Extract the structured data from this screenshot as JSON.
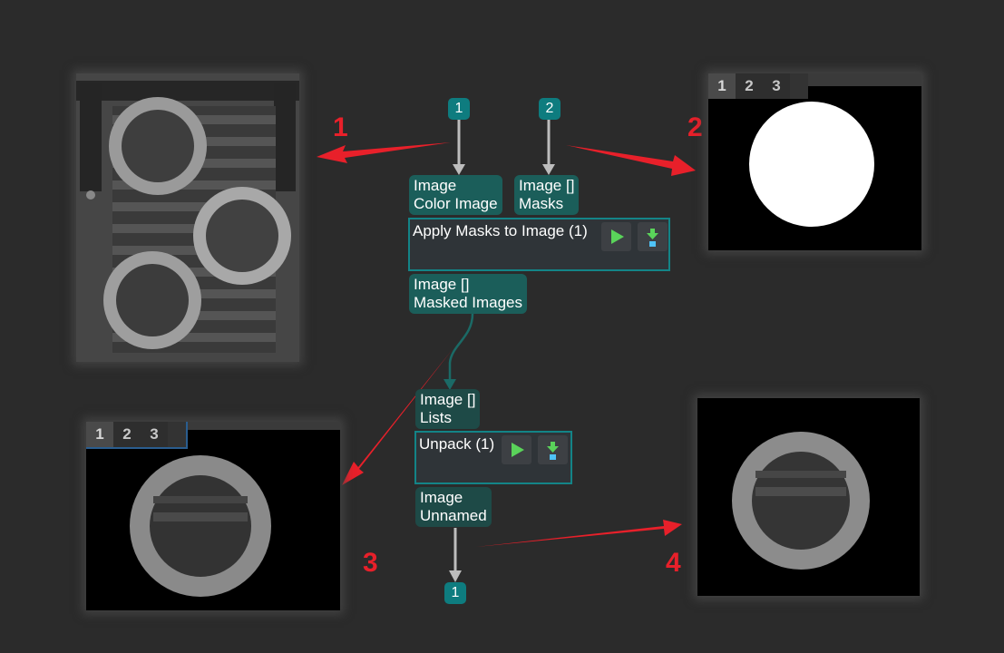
{
  "annotations": [
    "1",
    "2",
    "3",
    "4"
  ],
  "viewer_tabs": [
    "1",
    "2",
    "3"
  ],
  "graph": {
    "input_badges": [
      "1",
      "2"
    ],
    "output_badge": "1",
    "apply_masks_node": {
      "title": "Apply Masks to Image (1)",
      "inputs": [
        {
          "type": "Image",
          "name": "Color Image"
        },
        {
          "type": "Image []",
          "name": "Masks"
        }
      ],
      "output": {
        "type": "Image []",
        "name": "Masked Images"
      },
      "run_icon": "play-icon",
      "download_icon": "download-icon"
    },
    "unpack_node": {
      "title": "Unpack (1)",
      "input": {
        "type": "Image []",
        "name": "Lists"
      },
      "output": {
        "type": "Image",
        "name": "Unnamed"
      },
      "run_icon": "play-icon",
      "download_icon": "download-icon"
    }
  },
  "images": {
    "source": "Grayscale photo of three metal flanges on a grating",
    "mask": "White circle mask on black",
    "masked": "Single flange isolated on black",
    "unpacked": "Single flange isolated on black"
  },
  "colors": {
    "background": "#2b2b2b",
    "badge": "#0e7c7f",
    "node_border": "#138487",
    "port_upper": "#1b5e5a",
    "port_lower": "#1e4a47",
    "annotation_red": "#e8202a",
    "play_green": "#5ad35a",
    "download_blue": "#4fc3f7"
  }
}
